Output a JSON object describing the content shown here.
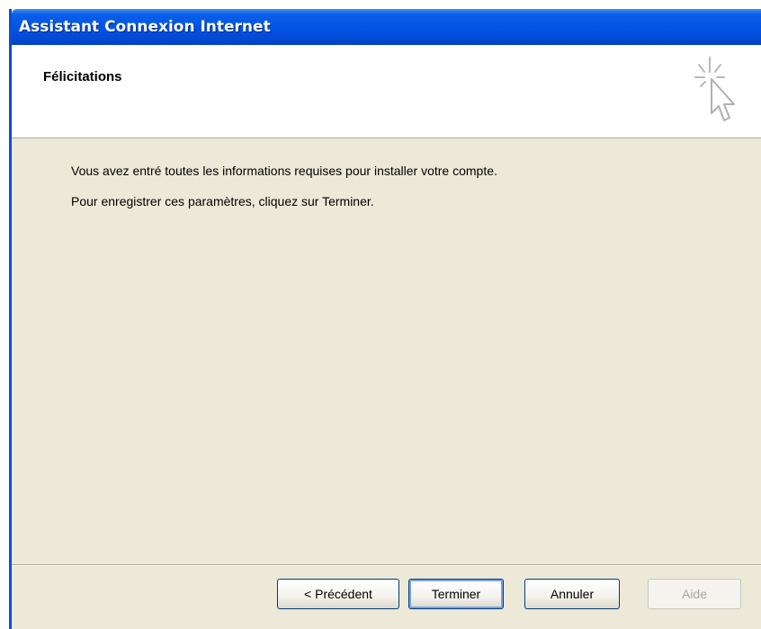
{
  "window": {
    "title": "Assistant Connexion Internet"
  },
  "header": {
    "title": "Félicitations",
    "icon": "wizard-cursor-icon"
  },
  "content": {
    "line1": "Vous avez entré toutes les informations requises pour installer votre compte.",
    "line2": "Pour enregistrer ces paramètres, cliquez sur Terminer."
  },
  "buttons": {
    "previous": "< Précédent",
    "finish": "Terminer",
    "cancel": "Annuler",
    "help": "Aide"
  },
  "colors": {
    "titlebar": "#0055e5",
    "dialog_background": "#ece9d8",
    "header_background": "#ffffff"
  }
}
